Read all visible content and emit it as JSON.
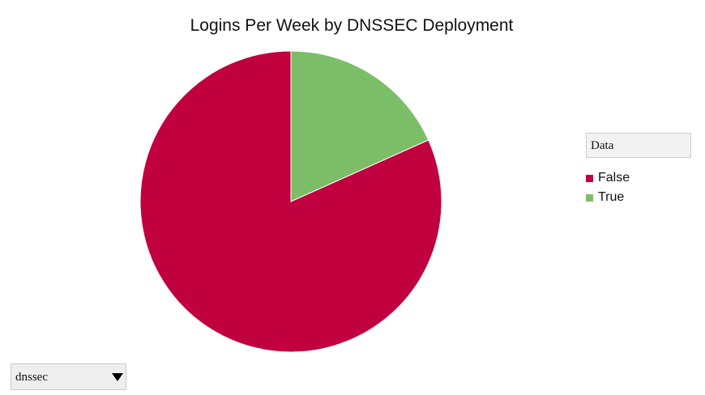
{
  "chart_data": {
    "type": "pie",
    "title": "Logins Per Week by DNSSEC Deployment",
    "categories": [
      "False",
      "True"
    ],
    "values": [
      81.7,
      18.3
    ],
    "colors": [
      "#c0003f",
      "#7bbe67"
    ],
    "legend": {
      "header": "Data",
      "placement": "right",
      "items": [
        "False",
        "True"
      ]
    }
  },
  "controls": {
    "selector_value": "dnssec",
    "selector_icon": "caret-down-icon"
  }
}
